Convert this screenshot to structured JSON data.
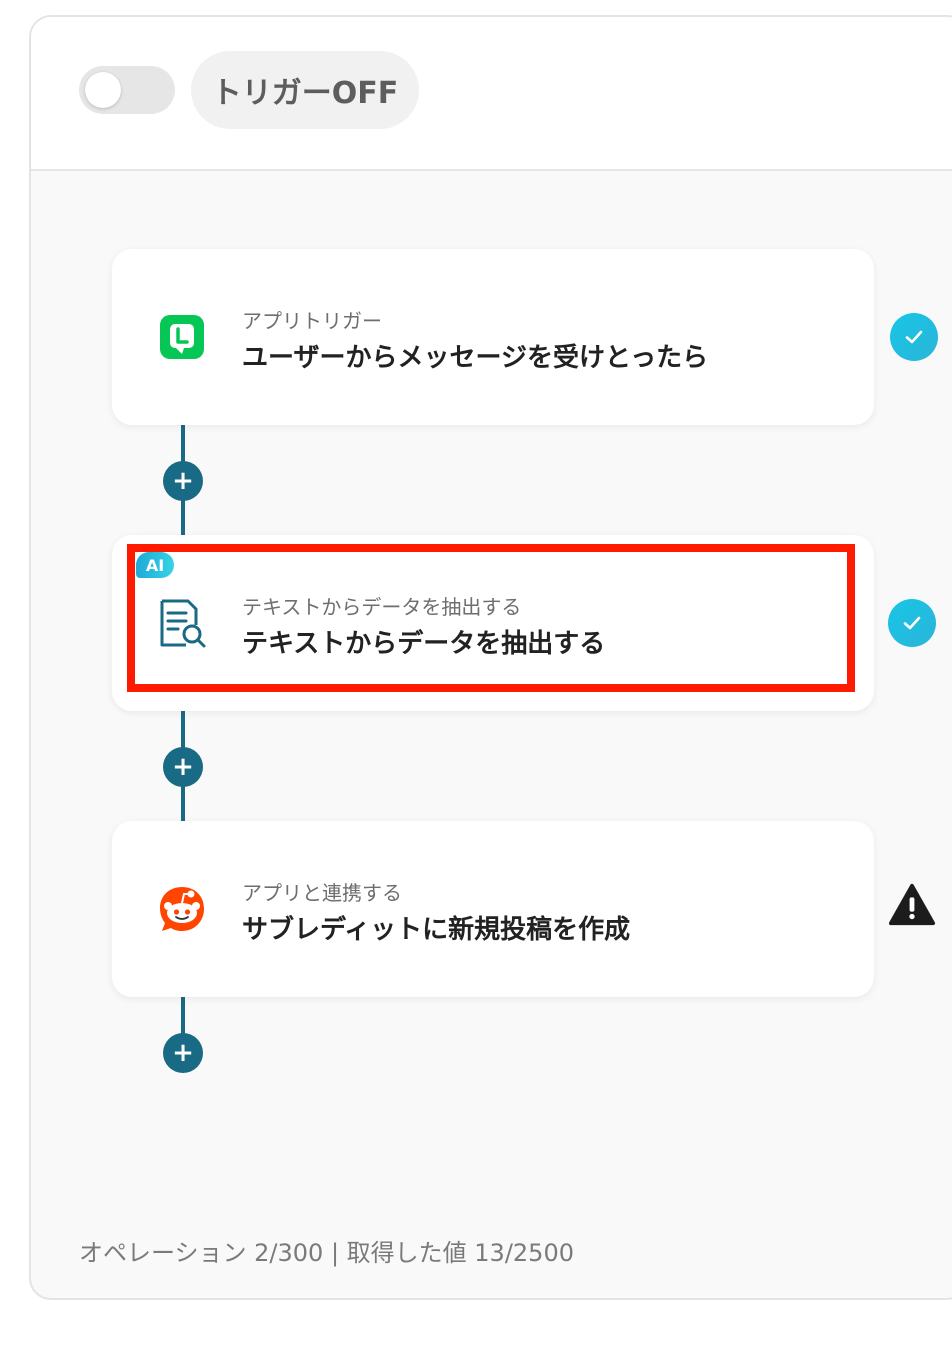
{
  "header": {
    "toggle_state": "off",
    "trigger_label": "トリガーOFF"
  },
  "steps": [
    {
      "subtitle": "アプリトリガー",
      "title": "ユーザーからメッセージを受けとったら",
      "icon": "line-app-icon",
      "status": "complete",
      "selected": false,
      "ai": false
    },
    {
      "badge": "AI",
      "subtitle": "テキストからデータを抽出する",
      "title": "テキストからデータを抽出する",
      "icon": "document-search-icon",
      "status": "complete",
      "selected": true,
      "ai": true
    },
    {
      "subtitle": "アプリと連携する",
      "title": "サブレディットに新規投稿を作成",
      "icon": "reddit-icon",
      "status": "warning",
      "selected": false,
      "ai": false
    }
  ],
  "add_step_symbol": "+",
  "footer": {
    "text": "オペレーション 2/300 | 取得した値 13/2500"
  },
  "colors": {
    "accent": "#196a84",
    "check": "#17c6e6",
    "highlight": "#ff1b00",
    "line_green": "#06c755",
    "reddit_orange": "#ff4500"
  }
}
